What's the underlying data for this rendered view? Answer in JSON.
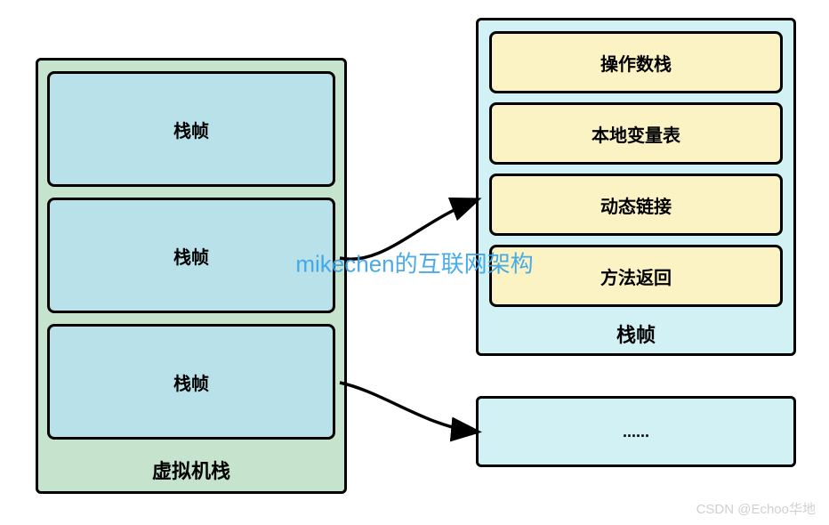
{
  "stack": {
    "title": "虚拟机栈",
    "frames": [
      "栈帧",
      "栈帧",
      "栈帧"
    ]
  },
  "detail": {
    "title": "栈帧",
    "items": [
      "操作数栈",
      "本地变量表",
      "动态链接",
      "方法返回"
    ]
  },
  "expand": {
    "label": "......"
  },
  "watermark": {
    "center": "mikechen的互联网架构",
    "bottom": "CSDN @Echoo华地"
  }
}
